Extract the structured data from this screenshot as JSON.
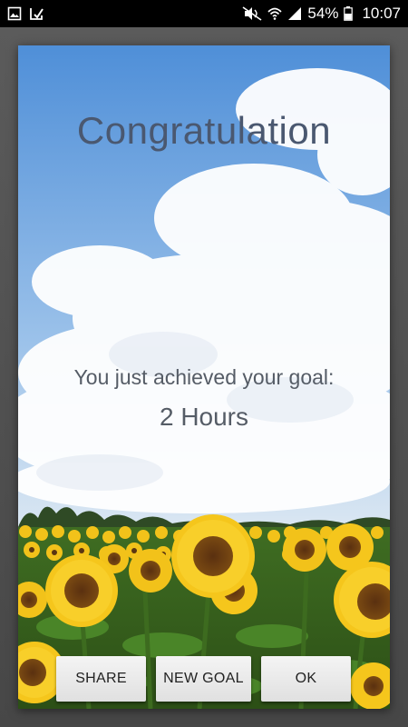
{
  "status_bar": {
    "battery": "54%",
    "time": "10:07",
    "icons": [
      "gallery-notification-icon",
      "app-notification-icon",
      "mute-icon",
      "wifi-icon",
      "signal-icon",
      "battery-icon"
    ]
  },
  "dialog": {
    "title": "Congratulation",
    "message": "You just achieved your goal:",
    "goal": "2 Hours",
    "buttons": {
      "share": "SHARE",
      "new_goal": "NEW GOAL",
      "ok": "OK"
    }
  },
  "colors": {
    "title_text": "#4a5870",
    "sky": "#5b9be0",
    "sunflower": "#f2c21a"
  }
}
